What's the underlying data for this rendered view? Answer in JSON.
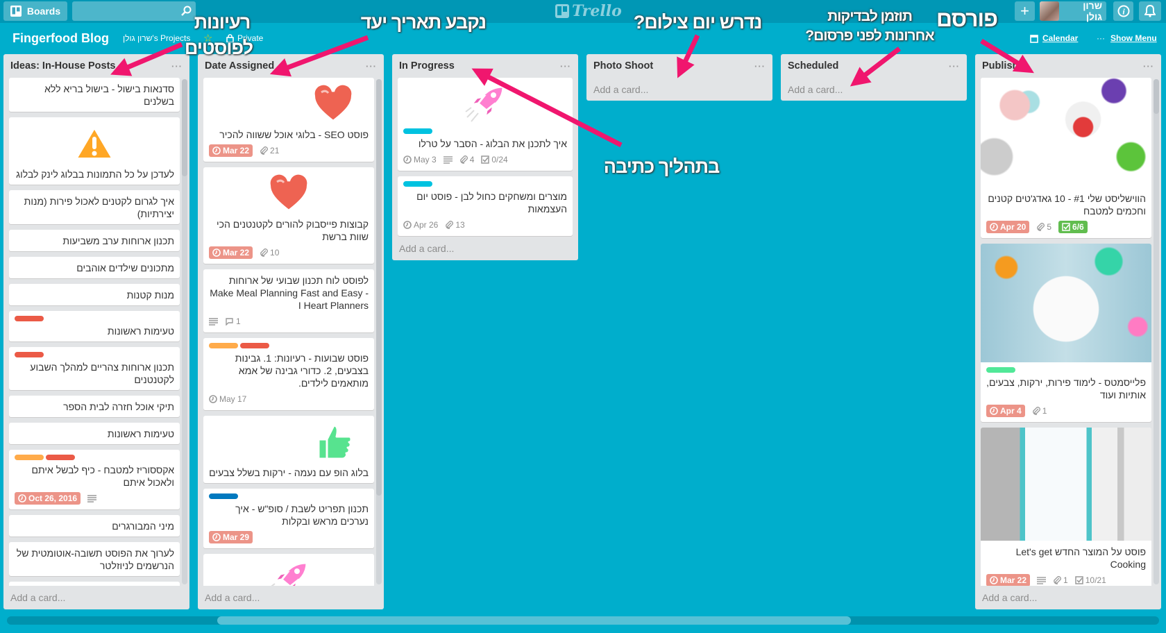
{
  "topbar": {
    "boards_label": "Boards",
    "search_value": "",
    "logo_text": "Trello",
    "user_name": "שרון גולן"
  },
  "board": {
    "title": "Fingerfood Blog",
    "team": "שרון גולן's Projects",
    "visibility": "Private",
    "calendar_label": "Calendar",
    "menu_label": "Show Menu"
  },
  "colors": {
    "red": "#eb5a46",
    "orange": "#ffab4a",
    "blue": "#0079bf",
    "sky": "#00c2e0",
    "green": "#51e898",
    "background": "#00aecc",
    "annotation": "#f0166e"
  },
  "annotations": {
    "ideas_line1": "רעיונות",
    "ideas_line2": "לפוסטים",
    "date_assigned": "נקבע תאריך יעד",
    "photo_shoot": "נדרש יום צילום?",
    "scheduled_line1": "תוזמן לבדיקות",
    "scheduled_line2": "אחרונות לפני פרסום?",
    "publish": "פורסם",
    "in_progress": "בתהליך כתיבה"
  },
  "add_card_label": "Add a card...",
  "lists": [
    {
      "title": "Ideas: In-House Posts",
      "scroll": true,
      "cards": [
        {
          "text": "סדנאות בישול - בישול בריא ללא בשלנים"
        },
        {
          "cover": "warning-icon",
          "text": "לעדכן על כל התמונות בבלוג לינק לבלוג"
        },
        {
          "text": "איך לגרום לקטנים לאכול פירות (מנות יצירתיות)"
        },
        {
          "text": "תכנון ארוחות ערב משביעות"
        },
        {
          "text": "מתכונים שילדים אוהבים"
        },
        {
          "text": "מנות קטנות"
        },
        {
          "labels": [
            "red"
          ],
          "text": "טעימות ראשונות"
        },
        {
          "labels": [
            "red"
          ],
          "text": "תכנון ארוחות צהריים למהלך השבוע לקטנטנים"
        },
        {
          "text": "תיקי אוכל חזרה לבית הספר"
        },
        {
          "text": "טעימות ראשונות"
        },
        {
          "labels": [
            "orange",
            "red"
          ],
          "text": "אקססוריז למטבח - כיף לבשל איתם ולאכול איתם",
          "due": "Oct 26, 2016",
          "due_overdue": true,
          "description": true
        },
        {
          "text": "מיני המבורגרים"
        },
        {
          "text": "לערוך את הפוסט תשובה-אוטומטית של הנרשמים לניוזלטר"
        },
        {
          "text": ""
        }
      ]
    },
    {
      "title": "Date Assigned",
      "scroll": true,
      "cards": [
        {
          "cover": "heart-icon",
          "cover_align": "right",
          "text": "פוסט SEO - בלוגי אוכל ששווה להכיר",
          "due": "Mar 22",
          "due_overdue": true,
          "attachments": "21"
        },
        {
          "cover": "heart-icon",
          "cover_align": "center",
          "text": "קבוצות פייסבוק להורים לקטנטנים הכי שוות ברשת",
          "due": "Mar 22",
          "due_overdue": true,
          "attachments": "10"
        },
        {
          "text": "לפוסט לוח תכנון שבועי של ארוחות Make Meal Planning Fast and Easy - I Heart Planners",
          "description": true,
          "comments": "1"
        },
        {
          "labels": [
            "orange",
            "red"
          ],
          "text": "פוסט שבועות - רעיונות: 1. גבינות בצבעים, 2. כדורי גבינה של אמא מותאמים לילדים.",
          "due": "May 17",
          "due_overdue": false
        },
        {
          "cover": "thumbs-up-icon",
          "cover_align": "right",
          "text": "בלוג הופ עם נעמה - ירקות בשלל צבעים"
        },
        {
          "labels": [
            "blue"
          ],
          "text": "תכנון תפריט לשבת / סופ\"ש - איך נערכים מראש ובקלות",
          "due": "Mar 29",
          "due_overdue": true
        },
        {
          "cover": "rocket-icon",
          "cover_align": "center",
          "labels": [
            "sky"
          ],
          "text": ""
        }
      ]
    },
    {
      "title": "In Progress",
      "cards": [
        {
          "cover": "rocket-icon",
          "cover_align": "center",
          "labels": [
            "sky"
          ],
          "text": "איך לתכנן את הבלוג - הסבר על טרלו",
          "due": "May 3",
          "due_overdue": false,
          "description": true,
          "attachments": "4",
          "checklist": "0/24"
        },
        {
          "labels": [
            "sky"
          ],
          "text": "מוצרים ומשחקים כחול לבן - פוסט יום העצמאות",
          "due": "Apr 26",
          "due_overdue": false,
          "attachments": "13"
        }
      ]
    },
    {
      "title": "Photo Shoot",
      "cards": []
    },
    {
      "title": "Scheduled",
      "cards": []
    },
    {
      "title": "Publish",
      "scroll": true,
      "cards": [
        {
          "image": "gadgets-photo",
          "text": "הווישליסט שלי #1 - 10 גאדג'טים קטנים וחכמים למטבח",
          "due": "Apr 20",
          "due_overdue": true,
          "attachments": "5",
          "checklist": "6/6",
          "checklist_done": true
        },
        {
          "image": "placemat-photo",
          "labels": [
            "green"
          ],
          "text": "פלייסמטס - לימוד פירות, ירקות, צבעים, אותיות ועוד",
          "due": "Apr 4",
          "due_overdue": true,
          "attachments": "1"
        },
        {
          "image": "fridge-planner-photo",
          "text": "פוסט על המוצר החדש Let's get Cooking",
          "due": "Mar 22",
          "due_overdue": true,
          "description": true,
          "attachments": "1",
          "checklist": "10/21"
        }
      ]
    }
  ]
}
